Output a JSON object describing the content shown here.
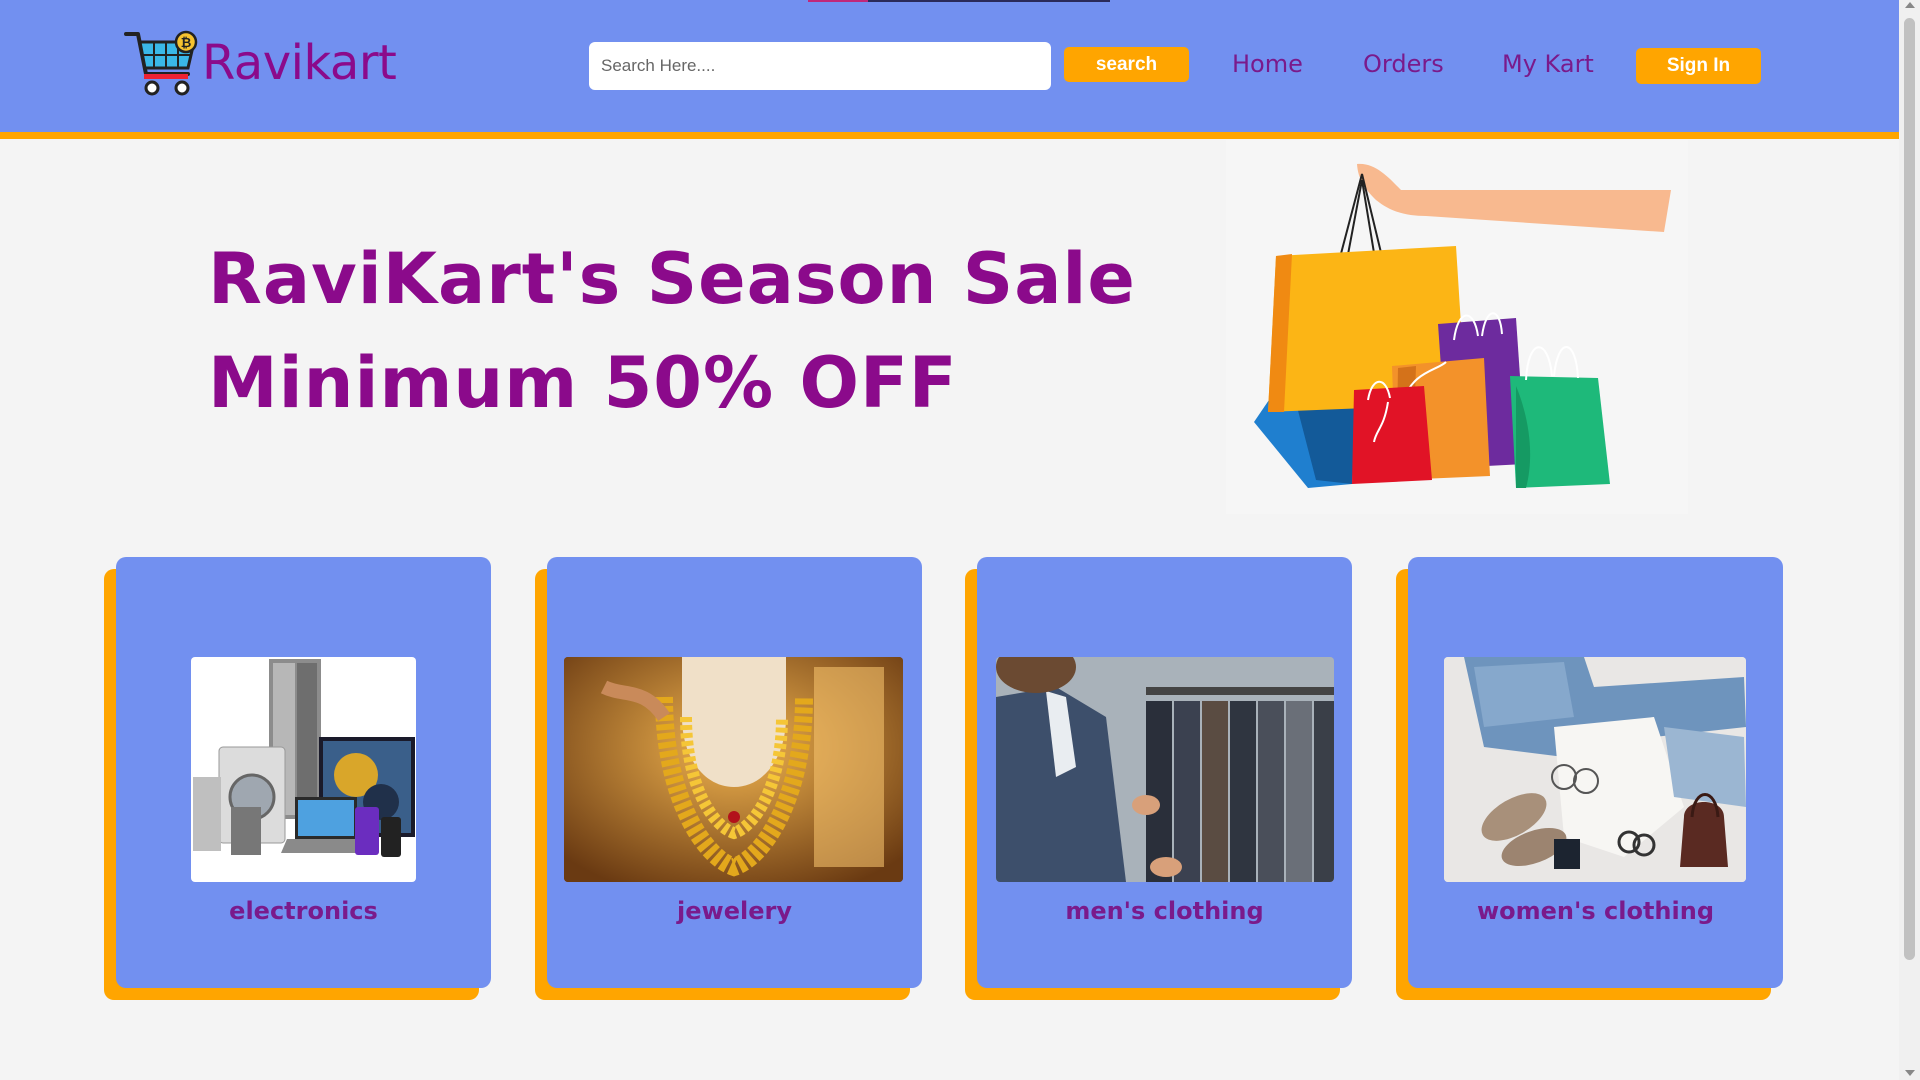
{
  "header": {
    "brand_name": "Ravikart",
    "logo_icon": "shopping-cart-icon",
    "search_placeholder": "Search Here....",
    "search_label": "search",
    "nav": [
      {
        "label": "Home"
      },
      {
        "label": "Orders"
      },
      {
        "label": "My Kart"
      }
    ],
    "signin_label": "Sign In"
  },
  "hero": {
    "line1": "RaviKart's Season Sale",
    "line2": "Minimum 50% OFF",
    "image": "shopping-bags-illustration"
  },
  "categories": [
    {
      "label": "electronics",
      "image": "electronics-appliances-photo"
    },
    {
      "label": "jewelery",
      "image": "gold-necklace-photo"
    },
    {
      "label": "men's clothing",
      "image": "mens-suits-photo"
    },
    {
      "label": "women's clothing",
      "image": "womens-outfit-photo"
    }
  ],
  "colors": {
    "header_bg": "#7290f0",
    "accent": "#ffa500",
    "brand_text": "#8b0a8b",
    "page_bg": "#f4f4f4"
  }
}
